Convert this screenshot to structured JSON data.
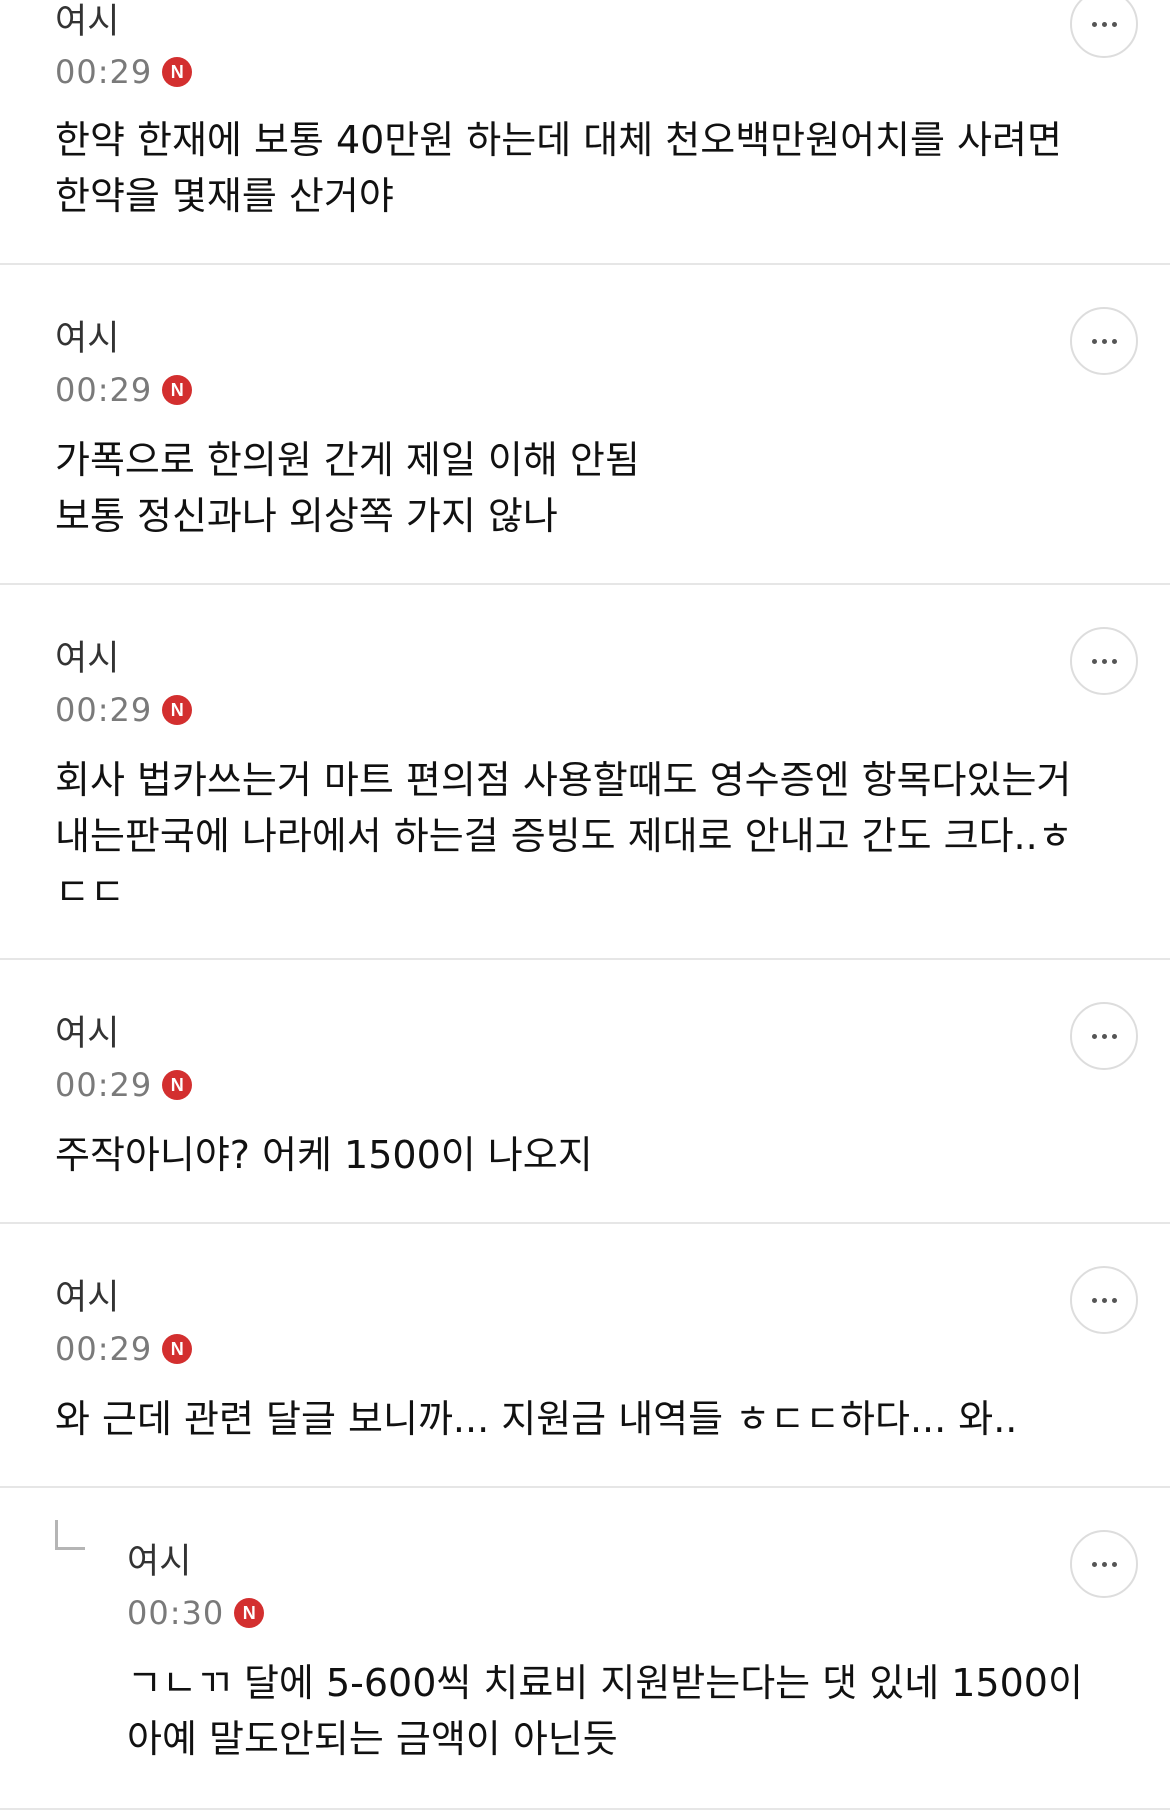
{
  "comments": [
    {
      "author": "여시",
      "time": "00:29",
      "badge": "N",
      "text": "한약 한재에 보통 40만원 하는데 대체 천오백만원어치를 사려면\n한약을 몇재를 산거야"
    },
    {
      "author": "여시",
      "time": "00:29",
      "badge": "N",
      "text": "가폭으로 한의원 간게 제일 이해 안됨\n보통 정신과나 외상쪽 가지 않나"
    },
    {
      "author": "여시",
      "time": "00:29",
      "badge": "N",
      "text": "회사 법카쓰는거 마트 편의점 사용할때도 영수증엔 항목다있는거\n내는판국에 나라에서 하는걸 증빙도 제대로 안내고 간도 크다..ㅎ\nㄷㄷ"
    },
    {
      "author": "여시",
      "time": "00:29",
      "badge": "N",
      "text": "주작아니야? 어케 1500이 나오지"
    },
    {
      "author": "여시",
      "time": "00:29",
      "badge": "N",
      "text": "와 근데 관련 달글 보니까... 지원금 내역들 ㅎㄷㄷ하다... 와.."
    },
    {
      "author": "여시",
      "time": "00:30",
      "badge": "N",
      "text": "ㄱㄴㄲ 달에 5-600씩 치료비 지원받는다는 댓 있네 1500이\n아예 말도안되는 금액이 아닌듯"
    }
  ],
  "colors": {
    "badge": "#d32f2f",
    "divider": "#e6e6e6",
    "time": "#7a7a7a"
  },
  "icons": {
    "more": "more-dots-icon",
    "reply": "reply-arrow-icon",
    "new": "new-badge-icon"
  }
}
